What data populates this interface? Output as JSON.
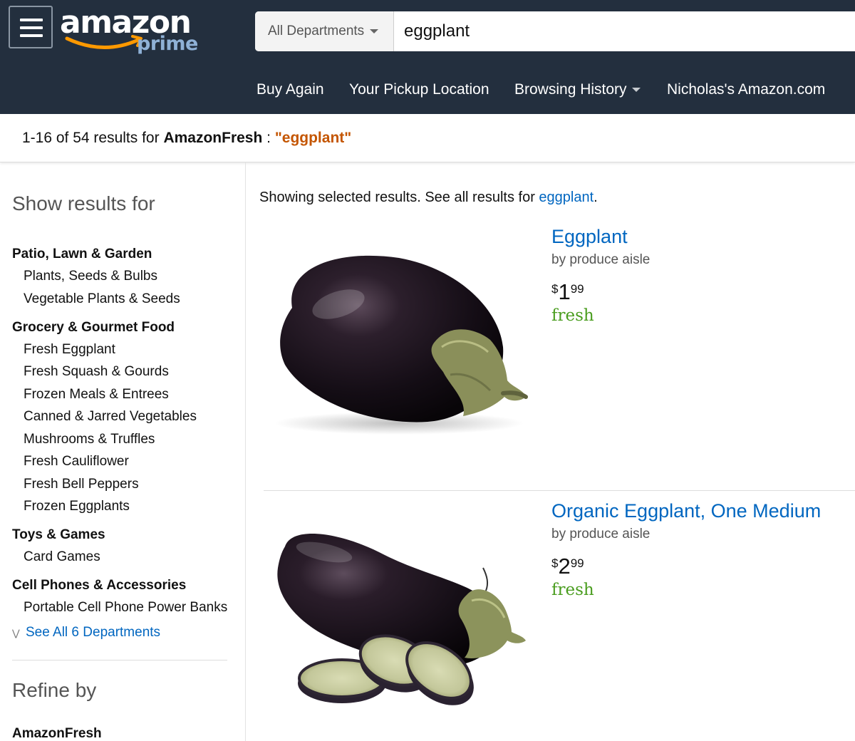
{
  "header": {
    "logo_main": "amazon",
    "logo_sub": "prime",
    "search": {
      "department": "All Departments",
      "query": "eggplant"
    },
    "nav": [
      "Buy Again",
      "Your Pickup Location",
      "Browsing History",
      "Nicholas's Amazon.com"
    ]
  },
  "results": {
    "range_text": "1-16 of 54 results for ",
    "store": "AmazonFresh",
    "separator": " : ",
    "query": "\"eggplant\""
  },
  "sidebar": {
    "heading": "Show results for",
    "categories": [
      {
        "name": "Patio, Lawn & Garden",
        "items": [
          "Plants, Seeds & Bulbs",
          "Vegetable Plants & Seeds"
        ]
      },
      {
        "name": "Grocery & Gourmet Food",
        "items": [
          "Fresh Eggplant",
          "Fresh Squash & Gourds",
          "Frozen Meals & Entrees",
          "Canned & Jarred Vegetables",
          "Mushrooms & Truffles",
          "Fresh Cauliflower",
          "Fresh Bell Peppers",
          "Frozen Eggplants"
        ]
      },
      {
        "name": "Toys & Games",
        "items": [
          "Card Games"
        ]
      },
      {
        "name": "Cell Phones & Accessories",
        "items": [
          "Portable Cell Phone Power Banks"
        ]
      }
    ],
    "see_all": "See All 6 Departments",
    "refine_heading": "Refine by",
    "refine_first": "AmazonFresh"
  },
  "main": {
    "showing_prefix": "Showing selected results. See all results for ",
    "showing_link": "eggplant",
    "showing_suffix": ".",
    "items": [
      {
        "title": "Eggplant",
        "by": "by produce aisle",
        "currency": "$",
        "price_whole": "1",
        "price_frac": "99",
        "badge": "fresh"
      },
      {
        "title": "Organic Eggplant, One Medium",
        "by": "by produce aisle",
        "currency": "$",
        "price_whole": "2",
        "price_frac": "99",
        "badge": "fresh"
      }
    ]
  },
  "colors": {
    "header_bg": "#232f3e",
    "link": "#0066c0",
    "query_highlight": "#c45500",
    "fresh_green": "#4a9d1f"
  }
}
